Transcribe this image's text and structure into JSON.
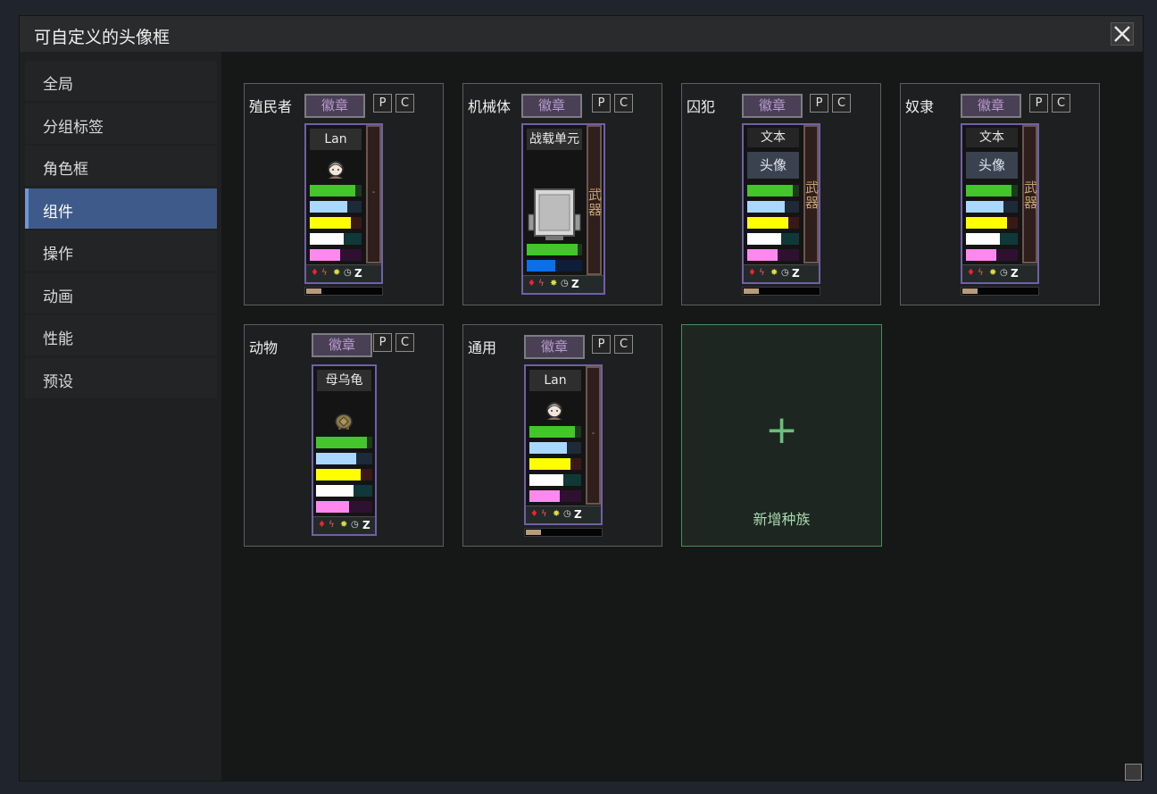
{
  "window": {
    "title": "可自定义的头像框"
  },
  "sidebar": {
    "items": [
      {
        "label": "全局"
      },
      {
        "label": "分组标签"
      },
      {
        "label": "角色框"
      },
      {
        "label": "组件"
      },
      {
        "label": "操作"
      },
      {
        "label": "动画"
      },
      {
        "label": "性能"
      },
      {
        "label": "预设"
      }
    ],
    "active": "组件"
  },
  "buttons": {
    "badge": "徽章",
    "p": "P",
    "c": "C"
  },
  "cards": {
    "colonist": {
      "label": "殖民者",
      "name": "Lan",
      "weapon": "-"
    },
    "mech": {
      "label": "机械体",
      "name": "战载单元",
      "weapon": "武器"
    },
    "prisoner": {
      "label": "囚犯",
      "name": "文本",
      "avatar": "头像",
      "weapon": "武器"
    },
    "slave": {
      "label": "奴隶",
      "name": "文本",
      "avatar": "头像",
      "weapon": "武器"
    },
    "animal": {
      "label": "动物",
      "name": "母乌龟"
    },
    "generic": {
      "label": "通用",
      "name": "Lan",
      "weapon": "-"
    }
  },
  "add_race": {
    "plus": "+",
    "label": "新增种族"
  },
  "status_icons": {
    "sleep": "Z"
  },
  "levels": {
    "colonist": {
      "health": 0.88,
      "rest": 0.72,
      "food": 0.8,
      "mood": 0.66,
      "joy": 0.58,
      "progress": 0.22
    },
    "mech": {
      "health": 0.92,
      "energy": 0.52
    },
    "prisoner": {
      "health": 0.88,
      "rest": 0.72,
      "food": 0.8,
      "mood": 0.66,
      "joy": 0.58,
      "progress": 0.22
    },
    "slave": {
      "health": 0.88,
      "rest": 0.72,
      "food": 0.8,
      "mood": 0.66,
      "joy": 0.58,
      "progress": 0.22
    },
    "animal": {
      "health": 0.9,
      "rest": 0.72,
      "food": 0.8,
      "mood": 0.66,
      "joy": 0.58
    },
    "generic": {
      "health": 0.88,
      "rest": 0.72,
      "food": 0.8,
      "mood": 0.66,
      "joy": 0.58,
      "progress": 0.22
    }
  },
  "colors": {
    "accent": "#3d5a8a",
    "portrait_border": "#7060a8",
    "add_border": "#4f8a5c",
    "health": "#44c52c",
    "rest": "#a8d8ff",
    "food": "#ffff00",
    "mood": "#ffffff",
    "joy": "#ff88ee",
    "energy": "#0a6fe8"
  }
}
